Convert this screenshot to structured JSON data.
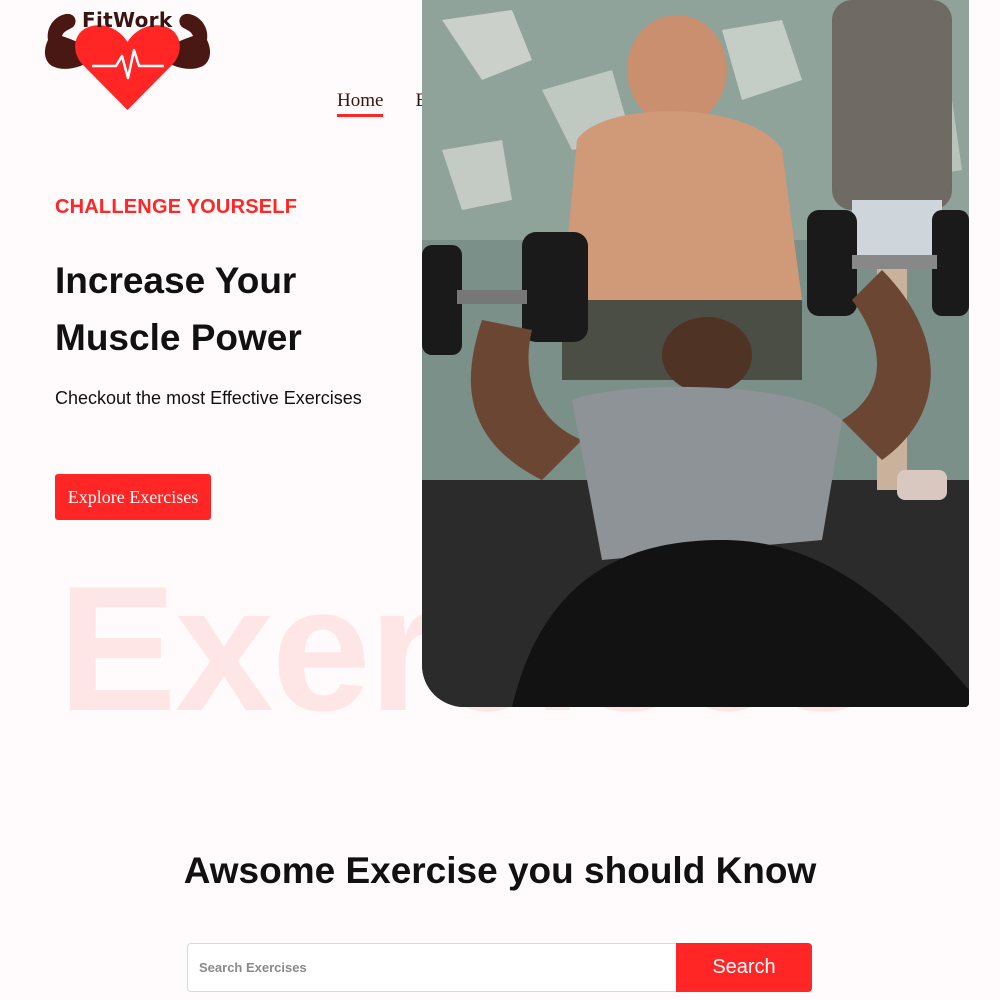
{
  "brand": {
    "name": "FitWork",
    "accent_color": "#ff2625",
    "dark_color": "#3a1410"
  },
  "nav": {
    "items": [
      {
        "label": "Home",
        "active": true
      },
      {
        "label": "E",
        "active": false
      }
    ]
  },
  "hero": {
    "eyebrow": "CHALLENGE YOURSELF",
    "headline_line1": "Increase Your",
    "headline_line2": "Muscle Power",
    "subhead": "Checkout the most Effective Exercises",
    "cta_label": "Explore Exercises",
    "watermark": "Exercises",
    "image": "bench-press-photo"
  },
  "section": {
    "title": "Awsome Exercise you should Know",
    "search": {
      "placeholder": "Search Exercises",
      "value": "",
      "button_label": "Search"
    }
  }
}
